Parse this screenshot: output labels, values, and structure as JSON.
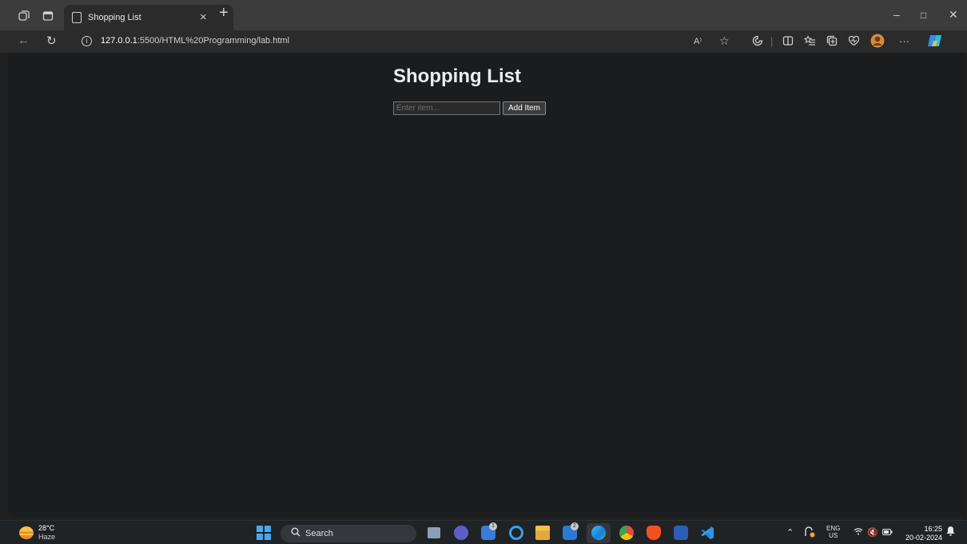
{
  "browser": {
    "tab_title": "Shopping List",
    "tab_close": "×",
    "new_tab": "+",
    "url_host": "127.0.0.1",
    "url_rest": ":5500/HTML%20Programming/lab.html",
    "read_aloud_label": "A⁾",
    "more_label": "···",
    "window": {
      "minimize": "–",
      "restore": "□",
      "close": "✕"
    }
  },
  "page": {
    "title": "Shopping List",
    "input_placeholder": "Enter item...",
    "input_value": "",
    "add_button_label": "Add Item"
  },
  "taskbar": {
    "weather_temp": "28°C",
    "weather_condition": "Haze",
    "search_label": "Search",
    "badges": {
      "teams": "1",
      "mail": "2"
    },
    "language_primary": "ENG",
    "language_secondary": "US",
    "time": "16:25",
    "date": "20-02-2024"
  },
  "colors": {
    "titlebar": "#3c3c3c",
    "toolbar": "#2b2b2b",
    "page_background": "#1b1c1e",
    "taskbar": "#202326",
    "accent": "#48a8f0"
  },
  "icons": {
    "titlebar": [
      "workspaces-icon",
      "tab-actions-icon",
      "page-icon"
    ],
    "toolbar": [
      "back-icon",
      "refresh-icon",
      "info-icon",
      "read-aloud-icon",
      "favorite-star-icon",
      "extensions-icon",
      "split-screen-icon",
      "favorites-icon",
      "collections-icon",
      "browser-essentials-icon",
      "profile-avatar-icon",
      "more-icon",
      "copilot-icon"
    ],
    "taskbar": [
      "weather-icon",
      "windows-start-icon",
      "search-icon",
      "task-view-icon",
      "teams-meet-icon",
      "microsoft-store-icon",
      "cortana-icon",
      "file-explorer-icon",
      "mail-icon",
      "edge-icon",
      "chrome-icon",
      "brave-icon",
      "word-icon",
      "vscode-icon",
      "chevron-up-icon",
      "copilot-tray-icon",
      "wifi-icon",
      "volume-muted-icon",
      "battery-icon",
      "notification-bell-icon"
    ]
  }
}
